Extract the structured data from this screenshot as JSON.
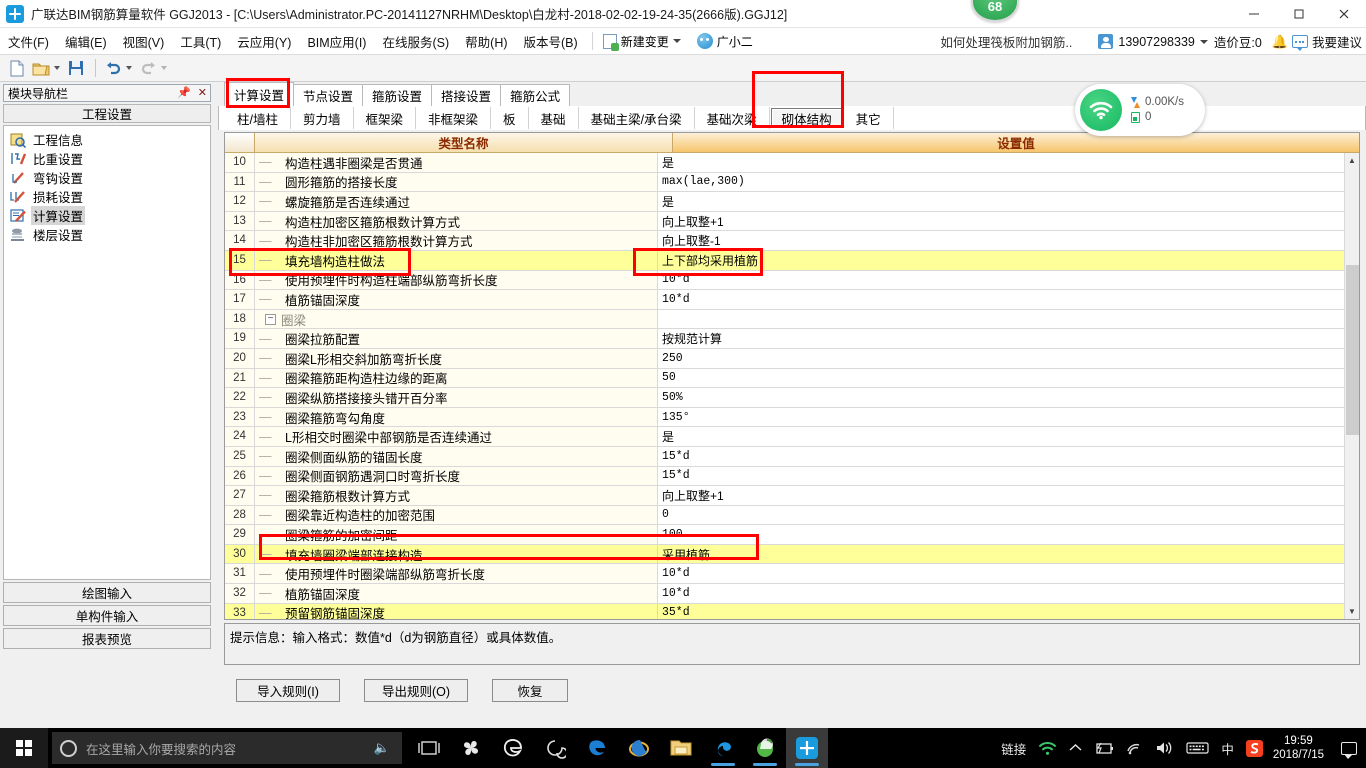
{
  "window": {
    "title": "广联达BIM钢筋算量软件 GGJ2013 - [C:\\Users\\Administrator.PC-20141127NRHM\\Desktop\\白龙村-2018-02-02-19-24-35(2666版).GGJ12]",
    "app_icon": "app-logo-icon",
    "minimize": "–",
    "maximize": "□",
    "close": "✕",
    "score_badge": "68"
  },
  "menubar": {
    "items": [
      {
        "label": "文件(F)"
      },
      {
        "label": "编辑(E)"
      },
      {
        "label": "视图(V)"
      },
      {
        "label": "工具(T)"
      },
      {
        "label": "云应用(Y)"
      },
      {
        "label": "BIM应用(I)"
      },
      {
        "label": "在线服务(S)"
      },
      {
        "label": "帮助(H)"
      },
      {
        "label": "版本号(B)"
      }
    ],
    "new_change": "新建变更",
    "user_name": "广小二",
    "ad_text": "如何处理筏板附加钢筋..",
    "phone": "13907298339",
    "beans": "造价豆:0",
    "suggest": "我要建议"
  },
  "left_panel": {
    "header_title": "模块导航栏",
    "pin_icon": "pin-icon",
    "close_icon": "close-icon",
    "section_title": "工程设置",
    "items": [
      {
        "label": "工程信息",
        "icon": "project-info-icon"
      },
      {
        "label": "比重设置",
        "icon": "weight-settings-icon"
      },
      {
        "label": "弯钩设置",
        "icon": "hook-settings-icon"
      },
      {
        "label": "损耗设置",
        "icon": "loss-settings-icon"
      },
      {
        "label": "计算设置",
        "icon": "calc-settings-icon"
      },
      {
        "label": "楼层设置",
        "icon": "floor-settings-icon"
      }
    ],
    "selected_item": "计算设置",
    "bottom_buttons": [
      "绘图输入",
      "单构件输入",
      "报表预览"
    ]
  },
  "toolbar": {
    "buttons": [
      "new-file-icon",
      "open-folder-icon",
      "save-icon",
      "undo-icon",
      "redo-icon"
    ]
  },
  "tabs_primary": [
    {
      "label": "计算设置",
      "active": true
    },
    {
      "label": "节点设置",
      "active": false
    },
    {
      "label": "箍筋设置",
      "active": false
    },
    {
      "label": "搭接设置",
      "active": false
    },
    {
      "label": "箍筋公式",
      "active": false
    }
  ],
  "tabs_secondary": [
    {
      "label": "柱/墙柱",
      "active": false
    },
    {
      "label": "剪力墙",
      "active": false
    },
    {
      "label": "框架梁",
      "active": false
    },
    {
      "label": "非框架梁",
      "active": false
    },
    {
      "label": "板",
      "active": false
    },
    {
      "label": "基础",
      "active": false
    },
    {
      "label": "基础主梁/承台梁",
      "active": false
    },
    {
      "label": "基础次梁",
      "active": false
    },
    {
      "label": "砌体结构",
      "active": true
    },
    {
      "label": "其它",
      "active": false
    }
  ],
  "grid": {
    "columns": [
      "",
      "类型名称",
      "设置值"
    ],
    "rows": [
      {
        "num": "10",
        "name": "构造柱遇非圈梁是否贯通",
        "value": "是",
        "type": "leaf",
        "mono": false,
        "highlight": false
      },
      {
        "num": "11",
        "name": "圆形箍筋的搭接长度",
        "value": "max(lae,300)",
        "type": "leaf",
        "mono": true,
        "highlight": false
      },
      {
        "num": "12",
        "name": "螺旋箍筋是否连续通过",
        "value": "是",
        "type": "leaf",
        "mono": false,
        "highlight": false
      },
      {
        "num": "13",
        "name": "构造柱加密区箍筋根数计算方式",
        "value": "向上取整+1",
        "type": "leaf",
        "mono": false,
        "highlight": false
      },
      {
        "num": "14",
        "name": "构造柱非加密区箍筋根数计算方式",
        "value": "向上取整-1",
        "type": "leaf",
        "mono": false,
        "highlight": false
      },
      {
        "num": "15",
        "name": "填充墙构造柱做法",
        "value": "上下部均采用植筋",
        "type": "leaf",
        "mono": false,
        "highlight": true
      },
      {
        "num": "16",
        "name": "使用预埋件时构造柱端部纵筋弯折长度",
        "value": "10*d",
        "type": "leaf",
        "mono": true,
        "highlight": false
      },
      {
        "num": "17",
        "name": "植筋锚固深度",
        "value": "10*d",
        "type": "leaf",
        "mono": true,
        "highlight": false
      },
      {
        "num": "18",
        "name": "圈梁",
        "value": "",
        "type": "group",
        "mono": false,
        "highlight": false
      },
      {
        "num": "19",
        "name": "圈梁拉筋配置",
        "value": "按规范计算",
        "type": "leaf",
        "mono": false,
        "highlight": false
      },
      {
        "num": "20",
        "name": "圈梁L形相交斜加筋弯折长度",
        "value": "250",
        "type": "leaf",
        "mono": true,
        "highlight": false
      },
      {
        "num": "21",
        "name": "圈梁箍筋距构造柱边缘的距离",
        "value": "50",
        "type": "leaf",
        "mono": true,
        "highlight": false
      },
      {
        "num": "22",
        "name": "圈梁纵筋搭接接头错开百分率",
        "value": "50%",
        "type": "leaf",
        "mono": true,
        "highlight": false
      },
      {
        "num": "23",
        "name": "圈梁箍筋弯勾角度",
        "value": "135°",
        "type": "leaf",
        "mono": true,
        "highlight": false
      },
      {
        "num": "24",
        "name": "L形相交时圈梁中部钢筋是否连续通过",
        "value": "是",
        "type": "leaf",
        "mono": false,
        "highlight": false
      },
      {
        "num": "25",
        "name": "圈梁侧面纵筋的锚固长度",
        "value": "15*d",
        "type": "leaf",
        "mono": true,
        "highlight": false
      },
      {
        "num": "26",
        "name": "圈梁侧面钢筋遇洞口时弯折长度",
        "value": "15*d",
        "type": "leaf",
        "mono": true,
        "highlight": false
      },
      {
        "num": "27",
        "name": "圈梁箍筋根数计算方式",
        "value": "向上取整+1",
        "type": "leaf",
        "mono": false,
        "highlight": false
      },
      {
        "num": "28",
        "name": "圈梁靠近构造柱的加密范围",
        "value": "0",
        "type": "leaf",
        "mono": true,
        "highlight": false
      },
      {
        "num": "29",
        "name": "圈梁箍筋的加密间距",
        "value": "100",
        "type": "leaf",
        "mono": true,
        "highlight": false
      },
      {
        "num": "30",
        "name": "填充墙圈梁端部连接构造",
        "value": "采用植筋",
        "type": "leaf",
        "mono": false,
        "highlight": true
      },
      {
        "num": "31",
        "name": "使用预埋件时圈梁端部纵筋弯折长度",
        "value": "10*d",
        "type": "leaf",
        "mono": true,
        "highlight": false
      },
      {
        "num": "32",
        "name": "植筋锚固深度",
        "value": "10*d",
        "type": "leaf",
        "mono": true,
        "highlight": false
      },
      {
        "num": "33",
        "name": "预留钢筋锚固深度",
        "value": "35*d",
        "type": "leaf",
        "mono": true,
        "highlight": true
      }
    ],
    "scroll_up_icon": "chevron-up-icon",
    "scroll_down_icon": "chevron-down-icon"
  },
  "hint": "提示信息：输入格式：数值*d（d为钢筋直径）或具体数值。",
  "action_buttons": [
    {
      "label": "导入规则(I)"
    },
    {
      "label": "导出规则(O)"
    },
    {
      "label": "恢复"
    }
  ],
  "net_widget": {
    "icon": "wifi-icon",
    "speed": "0.00K/s",
    "count": "0"
  },
  "taskbar": {
    "start_icon": "windows-start-icon",
    "search_placeholder": "在这里输入你要搜索的内容",
    "search_icon": "search-circle-icon",
    "mic_icon": "microphone-icon",
    "taskview_icon": "task-view-icon",
    "apps": [
      {
        "icon": "pinwheel-icon"
      },
      {
        "icon": "edge-legacy-icon"
      },
      {
        "icon": "spiral-icon"
      },
      {
        "icon": "edge-icon"
      },
      {
        "icon": "internet-explorer-icon"
      },
      {
        "icon": "file-explorer-icon"
      },
      {
        "icon": "gamepad-blue-icon"
      },
      {
        "icon": "green-browser-icon"
      },
      {
        "icon": "ggj-app-icon"
      }
    ],
    "tray_text": "链接",
    "tray_icons": [
      "wifi-green-icon",
      "chevron-up-icon",
      "battery-icon",
      "network-icon",
      "volume-icon",
      "keyboard-icon",
      "ime-chinese-icon",
      "sogou-icon"
    ],
    "ime_label": "中",
    "time": "19:59",
    "date": "2018/7/15",
    "notification_icon": "notification-icon"
  },
  "annotations": {
    "colors": {
      "red": "#ff0000",
      "highlight": "#ffff99",
      "header_orange": "#f6c56b"
    },
    "boxes": [
      {
        "name": "calc-settings-tab-annotation"
      },
      {
        "name": "masonry-structure-tab-annotation"
      },
      {
        "name": "row15-name-annotation"
      },
      {
        "name": "row15-value-annotation"
      },
      {
        "name": "row30-annotation"
      }
    ]
  }
}
